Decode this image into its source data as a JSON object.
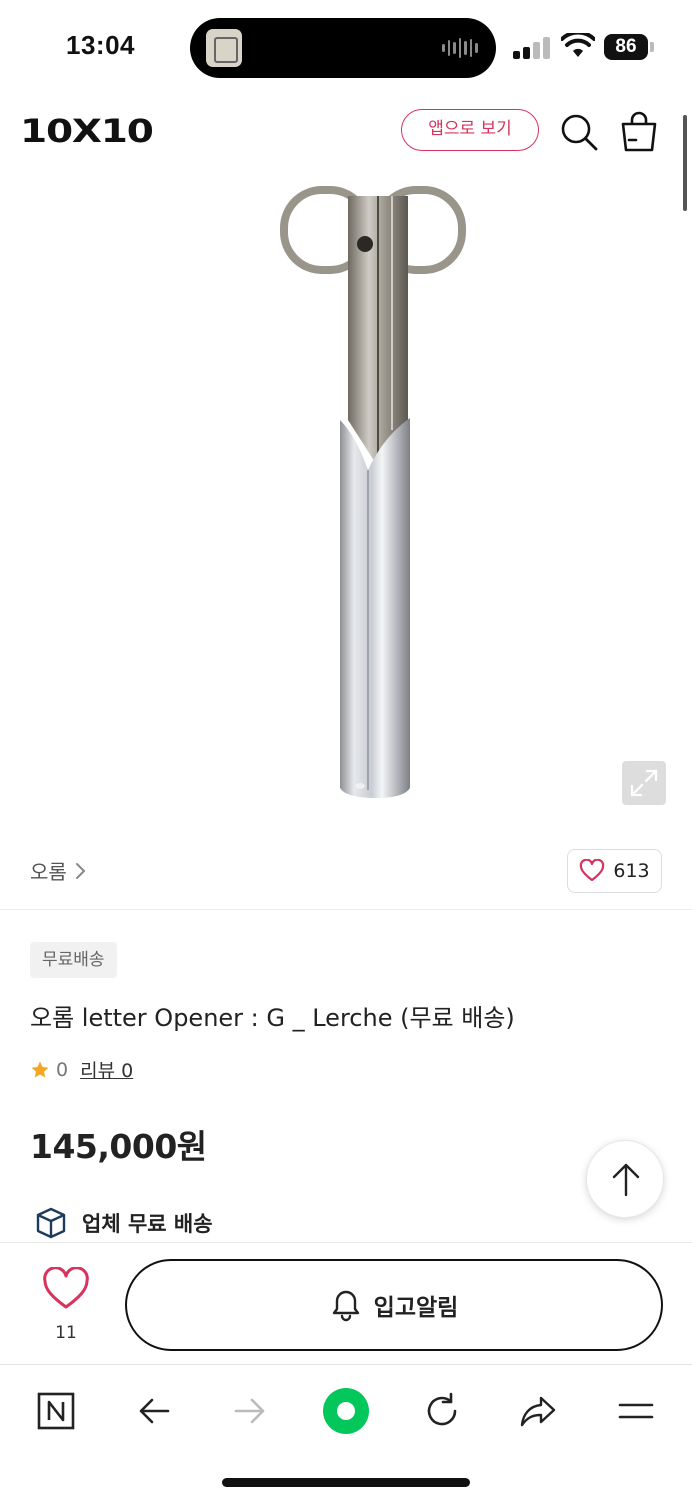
{
  "status_bar": {
    "time": "13:04",
    "battery": "86"
  },
  "header": {
    "logo": "10X10",
    "app_button": "앱으로 보기",
    "icons": [
      "search-icon",
      "shopping-bag-icon"
    ]
  },
  "brand": {
    "name": "오롬",
    "like_count": "613"
  },
  "product": {
    "badge": "무료배송",
    "title": "오롬 letter Opener : G _ Lerche (무료 배송)",
    "rating": "0",
    "review_label": "리뷰",
    "review_count": "0",
    "price": "145,000원",
    "shipping": "업체 무료 배송"
  },
  "purchase_bar": {
    "wish_count": "11",
    "notify_label": "입고알림"
  },
  "colors": {
    "accent": "#d6335e",
    "star": "#f5a623",
    "green": "#03c75a"
  }
}
